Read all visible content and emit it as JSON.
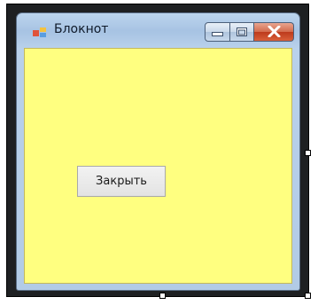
{
  "window": {
    "title": "Блокнот"
  },
  "title_bar": {
    "icon": "app-icon",
    "buttons": [
      "minimize-icon",
      "maximize-icon",
      "close-icon"
    ]
  },
  "form": {
    "background_color": "#ffff80",
    "close_button_label": "Закрыть"
  },
  "colors": {
    "form_background": "#ffff80",
    "close_caption_button": "#c9492b",
    "designer_frame": "#1e2022"
  }
}
